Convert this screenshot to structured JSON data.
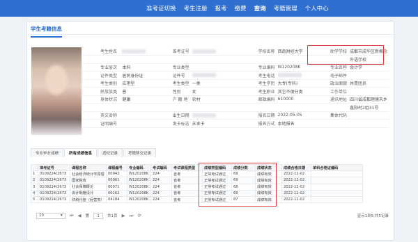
{
  "nav": [
    "准考证切换",
    "考生注册",
    "报考",
    "缴费",
    "查询",
    "考籍管理",
    "个人中心"
  ],
  "card_title": "学生考籍信息",
  "info_rows": [
    [
      "考生姓名",
      "",
      "准考证号",
      "",
      "学校名称",
      "西南财经大学",
      "助学学校",
      "成都市成华区新概念"
    ],
    [
      "",
      "",
      "",
      "",
      "",
      "",
      "",
      "外语学校"
    ],
    [
      "专业层次",
      "本科",
      "专业类型",
      "",
      "专业编码",
      "W120208K",
      "专业名称",
      "会计学"
    ],
    [
      "证件类型",
      "居民身份证",
      "证件号",
      "",
      "考生电话",
      "",
      "电子邮件",
      ""
    ],
    [
      "考生类别",
      "应用型",
      "考生类型",
      "一类",
      "考生学历",
      "大专(专科)",
      "政治面貌",
      "共青团员"
    ],
    [
      "民族族类",
      "普",
      "性别",
      "女",
      "考生职业",
      "其它不便分类",
      "工作单位",
      ""
    ],
    [
      "身体状况",
      "健康",
      "户 籍 地",
      "农村",
      "邮政编码",
      "610000",
      "通讯地址",
      "四川省成都理塘天乡"
    ],
    [
      "",
      "",
      "",
      "",
      "",
      "",
      "",
      "鑫阳村2组31号"
    ],
    [
      "英文名称",
      "",
      "出生日期",
      "",
      "报名日期",
      "2022-05-05",
      "集体代码",
      ""
    ],
    [
      "证明编号",
      "",
      "发卡标志",
      "未发卡",
      "报名方式",
      "本地报名",
      "",
      ""
    ]
  ],
  "sub_tabs": [
    "专业毕业成绩",
    "所有成绩信息",
    "违纪记录",
    "考籍移交记录"
  ],
  "grid_headers": [
    "",
    "准考证号",
    "课程名称",
    "课程编号",
    "专业编码",
    "考试编码",
    "考试课程类型",
    "成绩类型编码",
    "成绩分数",
    "成绩状态",
    "成绩合格日期",
    "单科合格证编码"
  ],
  "grid_rows": [
    [
      "1",
      "0109224(2673",
      "社会经济统计学原理",
      "00042",
      "W120208K",
      "224",
      "省考",
      "正常考试通过",
      "69",
      "成绩有效",
      "2022-11-02",
      ""
    ],
    [
      "2",
      "0109224(2673",
      "国家税收",
      "00061",
      "W120208K",
      "224",
      "省考",
      "正常考试通过",
      "69",
      "成绩有效",
      "2022-11-02",
      ""
    ],
    [
      "3",
      "0109224(2673",
      "社会保障概论",
      "00071",
      "W120208K",
      "224",
      "省考",
      "正常考试通过",
      "68",
      "成绩有效",
      "2022-11-02",
      ""
    ],
    [
      "4",
      "0109224(2673",
      "会计制度设计",
      "00162",
      "W120208K",
      "224",
      "省考",
      "正常考试通过",
      "69",
      "成绩有效",
      "2022-11-02",
      ""
    ],
    [
      "5",
      "0109224(2673",
      "财税代管（经营类）",
      "04184",
      "W120208K",
      "224",
      "省考",
      "正常考试通过",
      "87",
      "成绩有效",
      "2022-11-02",
      ""
    ]
  ],
  "pager": {
    "page_size": "10",
    "page_prefix": "第",
    "page": "1",
    "page_suffix": "共1页",
    "summary": "显示1到5,共5记录"
  }
}
